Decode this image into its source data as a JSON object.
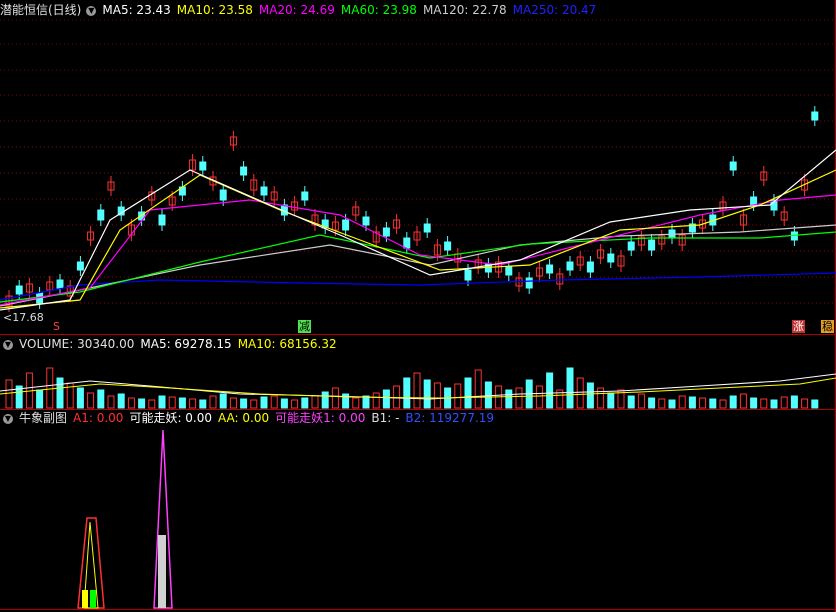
{
  "main": {
    "title": "潜能恒信(日线)",
    "ma5_label": "MA5: 23.43",
    "ma10_label": "MA10: 23.58",
    "ma20_label": "MA20: 24.69",
    "ma60_label": "MA60: 23.98",
    "ma120_label": "MA120: 22.78",
    "ma250_label": "MA250: 20.47",
    "low_price_label": "17.68",
    "tag_s_label": "S",
    "tag_jian_label": "减",
    "tag_zhang_label": "涨",
    "tag_wen_label": "稳",
    "colors": {
      "ma5": "#ffffff",
      "ma10": "#ffff00",
      "ma20": "#ff00ff",
      "ma60": "#00ff00",
      "ma120": "#cccccc",
      "ma250": "#0000ff",
      "up": "#ff3232",
      "down": "#54ffff"
    }
  },
  "volume": {
    "label": "VOLUME: 30340.00",
    "ma5_label": "MA5: 69278.15",
    "ma10_label": "MA10: 68156.32"
  },
  "indicator": {
    "name": "牛象副图",
    "a1_label": "A1: 0.00",
    "kzy_label": "可能走妖: 0.00",
    "aa_label": "AA: 0.00",
    "kzy1_label": "可能走妖1: 0.00",
    "b1_label": "B1: -",
    "b2_label": "B2: 119277.19"
  }
}
